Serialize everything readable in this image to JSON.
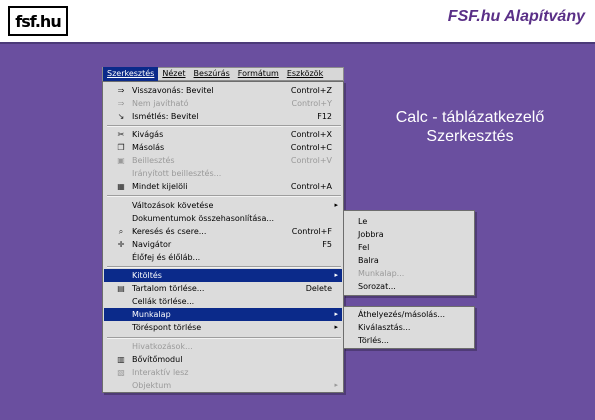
{
  "header": {
    "logo_text": "fsf.hu",
    "org_name": "FSF.hu Alapítvány"
  },
  "slide_title": {
    "line1": "Calc - táblázatkezelő",
    "line2": "Szerkesztés"
  },
  "menubar": {
    "items": [
      "Szerkesztés",
      "Nézet",
      "Beszúrás",
      "Formátum",
      "Eszközök"
    ]
  },
  "edit_menu": {
    "items": [
      {
        "label": "Visszavonás: Bevitel",
        "accel": "Control+Z",
        "icon": "undo-icon"
      },
      {
        "label": "Nem javítható",
        "accel": "Control+Y",
        "icon": "redo-icon",
        "disabled": true
      },
      {
        "label": "Ismétlés: Bevitel",
        "accel": "F12",
        "icon": "repeat-icon"
      },
      {
        "label": "Kivágás",
        "accel": "Control+X",
        "icon": "cut-icon"
      },
      {
        "label": "Másolás",
        "accel": "Control+C",
        "icon": "copy-icon"
      },
      {
        "label": "Beillesztés",
        "accel": "Control+V",
        "icon": "paste-icon",
        "disabled": true
      },
      {
        "label": "Irányított beillesztés...",
        "accel": "",
        "disabled": true
      },
      {
        "label": "Mindet kijelöli",
        "accel": "Control+A",
        "icon": "select-all-icon"
      },
      {
        "label": "Változások követése",
        "accel": "",
        "submenu": true
      },
      {
        "label": "Dokumentumok összehasonlítása...",
        "accel": ""
      },
      {
        "label": "Keresés és csere...",
        "accel": "Control+F",
        "icon": "find-replace-icon"
      },
      {
        "label": "Navigátor",
        "accel": "F5",
        "icon": "navigator-icon"
      },
      {
        "label": "Élőfej és élőláb...",
        "accel": ""
      },
      {
        "label": "Kitöltés",
        "accel": "",
        "submenu": true,
        "highlighted": true
      },
      {
        "label": "Tartalom törlése...",
        "accel": "Delete",
        "icon": "delete-contents-icon"
      },
      {
        "label": "Cellák törlése...",
        "accel": ""
      },
      {
        "label": "Munkalap",
        "accel": "",
        "submenu": true,
        "highlighted": true
      },
      {
        "label": "Töréspont törlése",
        "accel": "",
        "submenu": true
      },
      {
        "label": "Hivatkozások...",
        "accel": "",
        "disabled": true
      },
      {
        "label": "Bővítőmodul",
        "accel": "",
        "icon": "plugin-icon"
      },
      {
        "label": "Interaktív lesz",
        "accel": "",
        "icon": "imagemap-icon",
        "disabled": true
      },
      {
        "label": "Objektum",
        "accel": "",
        "submenu": true,
        "disabled": true
      }
    ]
  },
  "fill_submenu": {
    "items": [
      {
        "label": "Le"
      },
      {
        "label": "Jobbra"
      },
      {
        "label": "Fel"
      },
      {
        "label": "Balra"
      },
      {
        "label": "Munkalap...",
        "disabled": true
      },
      {
        "label": "Sorozat..."
      }
    ]
  },
  "sheet_submenu": {
    "items": [
      {
        "label": "Áthelyezés/másolás..."
      },
      {
        "label": "Kiválasztás..."
      },
      {
        "label": "Törlés..."
      }
    ]
  },
  "colors": {
    "background": "#6a4f9f",
    "menu_bg": "#dcdcdc",
    "highlight": "#0b2a8a",
    "brand_text": "#5a2f87"
  }
}
